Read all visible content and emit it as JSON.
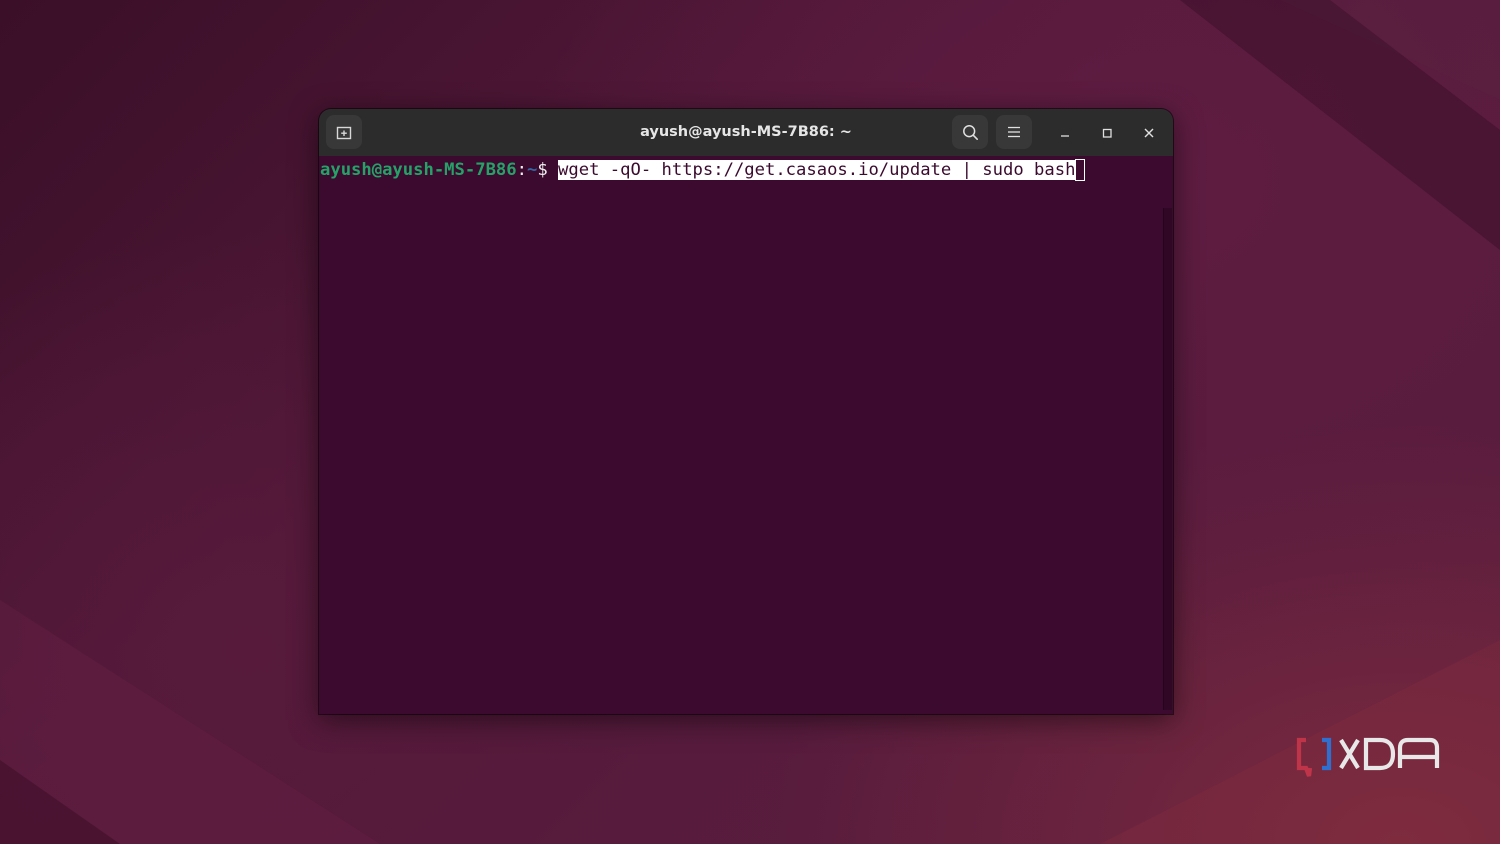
{
  "window": {
    "title": "ayush@ayush-MS-7B86: ~"
  },
  "titlebar": {
    "new_tab_icon": "new-tab-icon",
    "search_icon": "search-icon",
    "menu_icon": "hamburger-menu-icon",
    "minimize_icon": "minimize-icon",
    "maximize_icon": "maximize-icon",
    "close_icon": "close-icon"
  },
  "terminal": {
    "prompt_user_host": "ayush@ayush-MS-7B86",
    "prompt_colon": ":",
    "prompt_path": "~",
    "prompt_symbol": "$ ",
    "command": "wget -qO- https://get.casaos.io/update | sudo bash"
  },
  "watermark": {
    "brand": "XDA"
  },
  "colors": {
    "terminal_background": "#3b0a2e",
    "titlebar_background": "#2c2c2c",
    "prompt_user": "#26a269",
    "prompt_path": "#3465a4",
    "selection_background": "#ffffff"
  }
}
